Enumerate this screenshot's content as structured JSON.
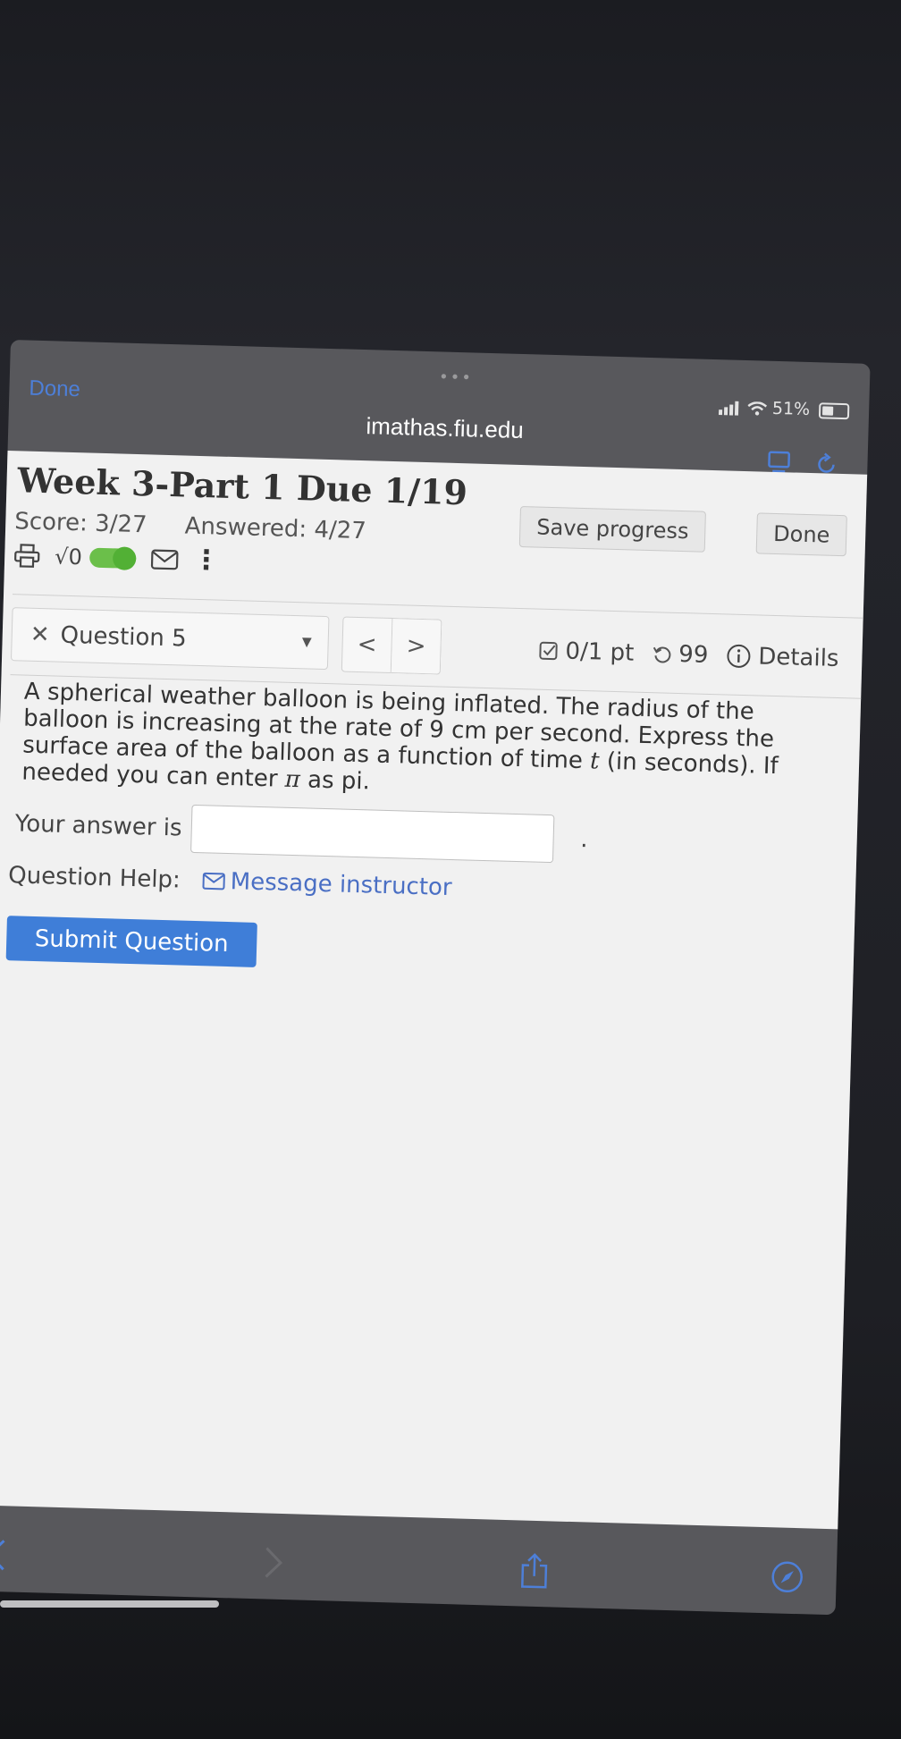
{
  "browser": {
    "done_label": "Done",
    "url": "imathas.fiu.edu",
    "battery": "51%",
    "tab_dots": "•••"
  },
  "assignment": {
    "title": "Week 3-Part 1 Due 1/19",
    "score": "Score: 3/27",
    "answered": "Answered: 4/27",
    "sqrt_label": "√0",
    "save_label": "Save progress",
    "done_label": "Done"
  },
  "question": {
    "selector_label": "Question 5",
    "prev": "<",
    "next": ">",
    "points": "0/1 pt",
    "attempts": "99",
    "details": "Details",
    "text_1": "A spherical weather balloon is being inflated. The radius of the balloon is increasing at the rate of 9 cm per second. Express the surface area of the balloon as a function of time ",
    "var_t": "t",
    "text_2": " (in seconds). If needed you can enter ",
    "pi_symbol": "π",
    "text_3": " as pi.",
    "answer_label": "Your answer is",
    "answer_value": "",
    "period": ".",
    "help_label": "Question Help:",
    "message_label": "Message instructor",
    "submit_label": "Submit Question"
  },
  "colors": {
    "accent": "#3f7ed8",
    "link": "#4a6fc4",
    "toggle": "#6bbf4a"
  }
}
